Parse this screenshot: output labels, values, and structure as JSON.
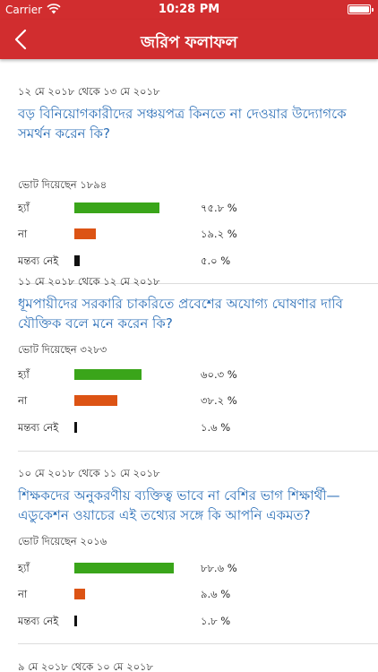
{
  "statusbar": {
    "carrier": "Carrier",
    "time": "10:28 PM"
  },
  "navbar": {
    "title": "জরিপ ফলাফল"
  },
  "colors": {
    "yes": "#3aa51a",
    "no": "#dc5314",
    "none": "#111111",
    "accent": "#d12d2f",
    "link": "#2c6fb7"
  },
  "polls": [
    {
      "date": "১২ মে ২০১৮ থেকে ১৩ মে ২০১৮",
      "question": "বড় বিনিয়োগকারীদের সঞ্চয়পত্র কিনতে না দেওয়ার উদ্যোগকে সমর্থন করেন কি?",
      "votes_text": "ভোট দিয়েছেন ১৮৯৪",
      "options": [
        {
          "label": "হ্যাঁ",
          "percent_text": "৭৫.৮ %",
          "percent": 75.8
        },
        {
          "label": "না",
          "percent_text": "১৯.২ %",
          "percent": 19.2
        },
        {
          "label": "মন্তব্য নেই",
          "percent_text": "৫.০ %",
          "percent": 5.0
        }
      ]
    },
    {
      "date": "১১ মে ২০১৮ থেকে ১২ মে ২০১৮",
      "question": "ধূমপায়ীদের সরকারি চাকরিতে প্রবেশের অযোগ্য ঘোষণার দাবি যৌক্তিক বলে মনে করেন কি?",
      "votes_text": "ভোট দিয়েছেন ৩২৮৩",
      "options": [
        {
          "label": "হ্যাঁ",
          "percent_text": "৬০.৩ %",
          "percent": 60.3
        },
        {
          "label": "না",
          "percent_text": "৩৮.২ %",
          "percent": 38.2
        },
        {
          "label": "মন্তব্য নেই",
          "percent_text": "১.৬ %",
          "percent": 1.6
        }
      ]
    },
    {
      "date": "১০ মে ২০১৮ থেকে ১১ মে ২০১৮",
      "question": "শিক্ষকদের অনুকরণীয় ব্যক্তিত্ব ভাবে না বেশির ভাগ শিক্ষার্থী— এডুকেশন ওয়াচের এই তথ্যের সঙ্গে কি আপনি একমত?",
      "votes_text": "ভোট দিয়েছেন ২০১৬",
      "options": [
        {
          "label": "হ্যাঁ",
          "percent_text": "৮৮.৬ %",
          "percent": 88.6
        },
        {
          "label": "না",
          "percent_text": "৯.৬ %",
          "percent": 9.6
        },
        {
          "label": "মন্তব্য নেই",
          "percent_text": "১.৮ %",
          "percent": 1.8
        }
      ]
    },
    {
      "date": "৯ মে ২০১৮ থেকে ১০ মে ২০১৮"
    }
  ]
}
